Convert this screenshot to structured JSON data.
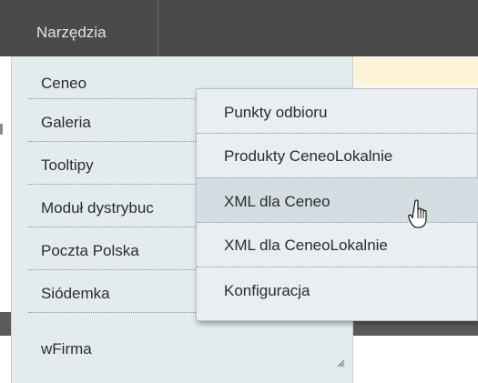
{
  "toolbar": {
    "tab_label": "Narzędzia"
  },
  "menu": {
    "items": [
      {
        "label": "Ceneo"
      },
      {
        "label": "Galeria"
      },
      {
        "label": "Tooltipy"
      },
      {
        "label": "Moduł dystrybuc"
      },
      {
        "label": "Poczta Polska"
      },
      {
        "label": "Siódemka"
      },
      {
        "label": "wFirma"
      }
    ]
  },
  "submenu": {
    "items": [
      {
        "label": "Punkty odbioru"
      },
      {
        "label": "Produkty CeneoLokalnie"
      },
      {
        "label": "XML dla Ceneo",
        "highlighted": true
      },
      {
        "label": "XML dla CeneoLokalnie"
      },
      {
        "label": "Konfiguracja"
      }
    ]
  },
  "icons": {
    "cursor": "hand-pointer-icon",
    "grip": "resize-grip-icon"
  },
  "colors": {
    "topbar": "#4a4a4a",
    "menu_bg": "#e4ebef",
    "highlight": "#d4dde2"
  }
}
